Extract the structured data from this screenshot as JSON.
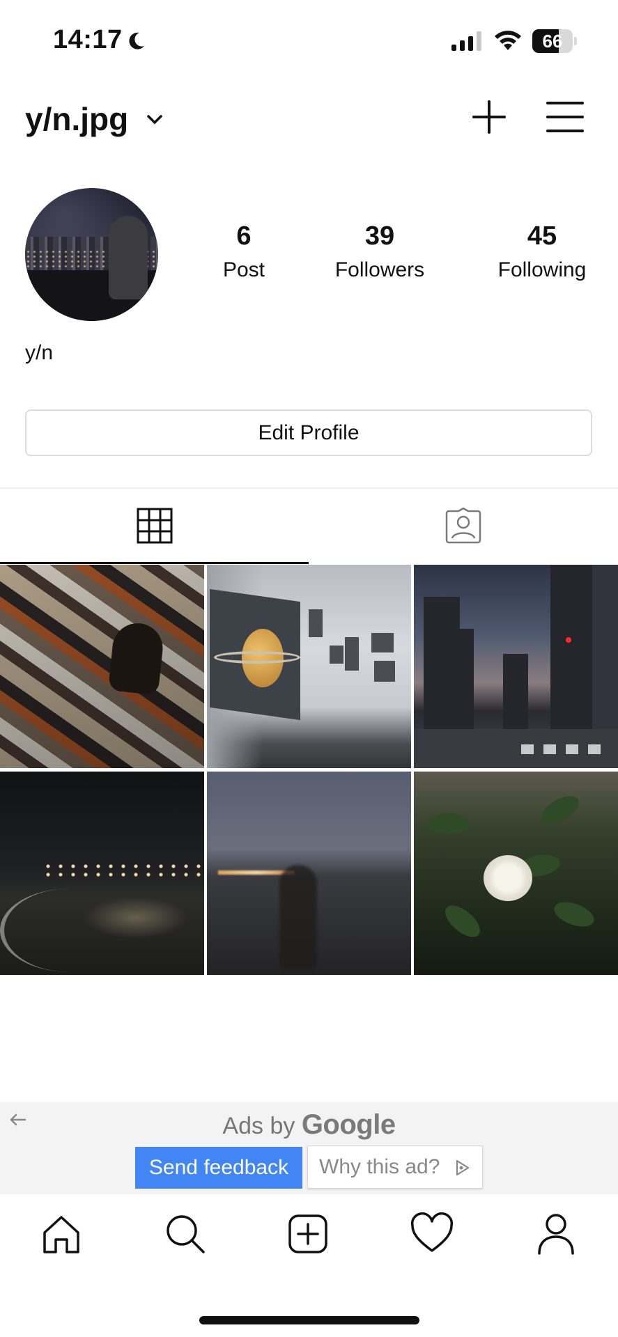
{
  "status_bar": {
    "time": "14:17",
    "battery": "66",
    "battery_level": 0.66
  },
  "header": {
    "username": "y/n.jpg",
    "icons": [
      "chevron-down-icon",
      "plus-icon",
      "hamburger-menu-icon"
    ]
  },
  "profile": {
    "display_name": "y/n",
    "stats": [
      {
        "value": "6",
        "label": "Post"
      },
      {
        "value": "39",
        "label": "Followers"
      },
      {
        "value": "45",
        "label": "Following"
      }
    ],
    "edit_profile_label": "Edit Profile"
  },
  "tabs": [
    {
      "name": "posts-grid",
      "icon": "grid-icon",
      "active": true
    },
    {
      "name": "tagged",
      "icon": "tagged-person-icon",
      "active": false
    }
  ],
  "posts": [
    {
      "image": "cd-album-covers-pile"
    },
    {
      "image": "saturn-art-gallery"
    },
    {
      "image": "city-street-dusk"
    },
    {
      "image": "night-beach-shore-lights"
    },
    {
      "image": "blurry-figure-sea-dusk"
    },
    {
      "image": "white-gardenia-flower"
    }
  ],
  "ad": {
    "ads_by": "Ads by",
    "brand": "Google",
    "send_feedback": "Send feedback",
    "why_this_ad": "Why this ad?",
    "accent": "#4285f4"
  },
  "bottom_nav": [
    "home-icon",
    "search-icon",
    "create-post-icon",
    "heart-icon",
    "profile-icon"
  ]
}
